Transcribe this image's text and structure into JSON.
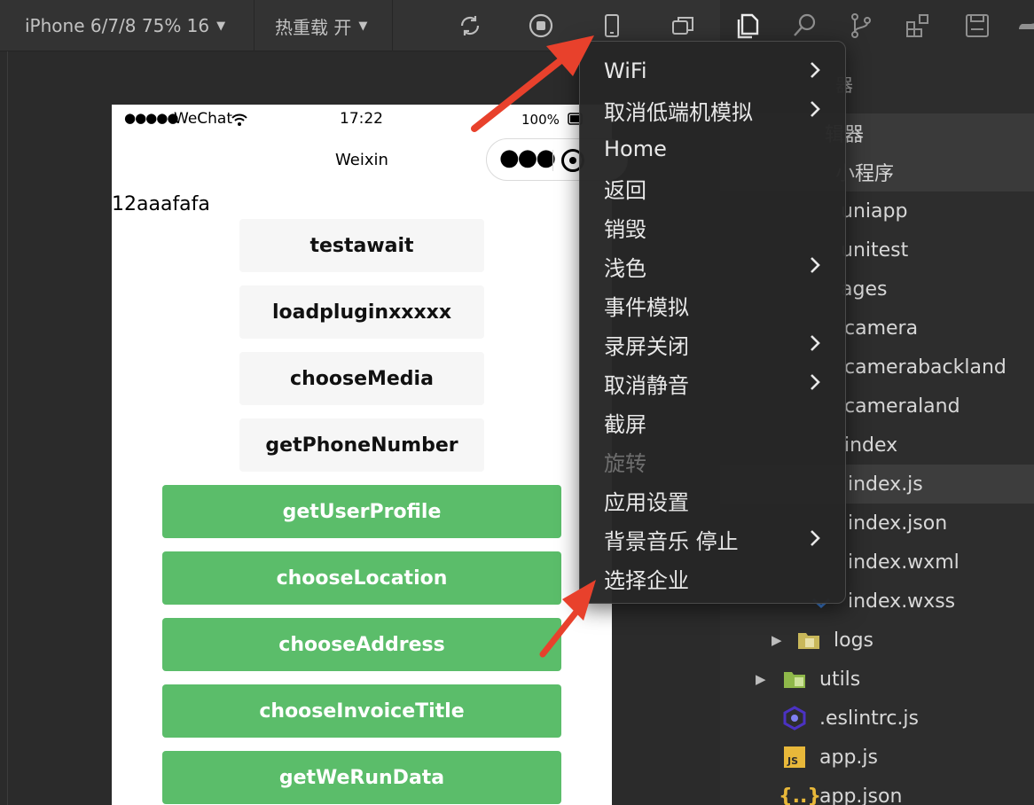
{
  "toolbar": {
    "device": "iPhone 6/7/8 75% 16",
    "hotreload": "热重载 开",
    "icons": [
      "refresh-icon",
      "stop-icon",
      "phone-icon",
      "window-icon"
    ]
  },
  "right_toolbar": {
    "icons": [
      "copy-icon",
      "search-icon",
      "branch-icon",
      "extension-icon",
      "save-icon",
      "cloud-icon"
    ]
  },
  "tree": {
    "header1": "器",
    "header2": "辑器",
    "header3": "小程序",
    "rows": [
      "uniapp",
      "unitest",
      "ages",
      "camera",
      "camerabackland",
      "cameraland",
      "index",
      "index.js",
      "index.json",
      "index.wxml",
      "index.wxss",
      "logs",
      "utils",
      ".eslintrc.js",
      "app.js",
      "app.json"
    ]
  },
  "phone": {
    "status": {
      "dots": "●●●●●",
      "carrier": "WeChat",
      "time": "17:22",
      "battery": "100%"
    },
    "nav_title": "Weixin",
    "page_text": "12aaafafa",
    "gray_buttons": [
      "testawait",
      "loadpluginxxxxx",
      "chooseMedia",
      "getPhoneNumber"
    ],
    "green_buttons": [
      "getUserProfile",
      "chooseLocation",
      "chooseAddress",
      "chooseInvoiceTitle",
      "getWeRunData"
    ]
  },
  "menu": {
    "items": [
      {
        "label": "WiFi",
        "submenu": true,
        "disabled": false
      },
      {
        "label": "取消低端机模拟",
        "submenu": true,
        "disabled": false
      },
      {
        "label": "Home",
        "submenu": false,
        "disabled": false
      },
      {
        "label": "返回",
        "submenu": false,
        "disabled": false
      },
      {
        "label": "销毁",
        "submenu": false,
        "disabled": false
      },
      {
        "label": "浅色",
        "submenu": true,
        "disabled": false
      },
      {
        "label": "事件模拟",
        "submenu": false,
        "disabled": false
      },
      {
        "label": "录屏关闭",
        "submenu": true,
        "disabled": false
      },
      {
        "label": "取消静音",
        "submenu": true,
        "disabled": false
      },
      {
        "label": "截屏",
        "submenu": false,
        "disabled": false
      },
      {
        "label": "旋转",
        "submenu": false,
        "disabled": true
      },
      {
        "label": "应用设置",
        "submenu": false,
        "disabled": false
      },
      {
        "label": "背景音乐 停止",
        "submenu": true,
        "disabled": false
      },
      {
        "label": "选择企业",
        "submenu": false,
        "disabled": false
      }
    ]
  },
  "colors": {
    "green_button": "#5bbd6a",
    "annotation_arrow": "#e8412c"
  }
}
